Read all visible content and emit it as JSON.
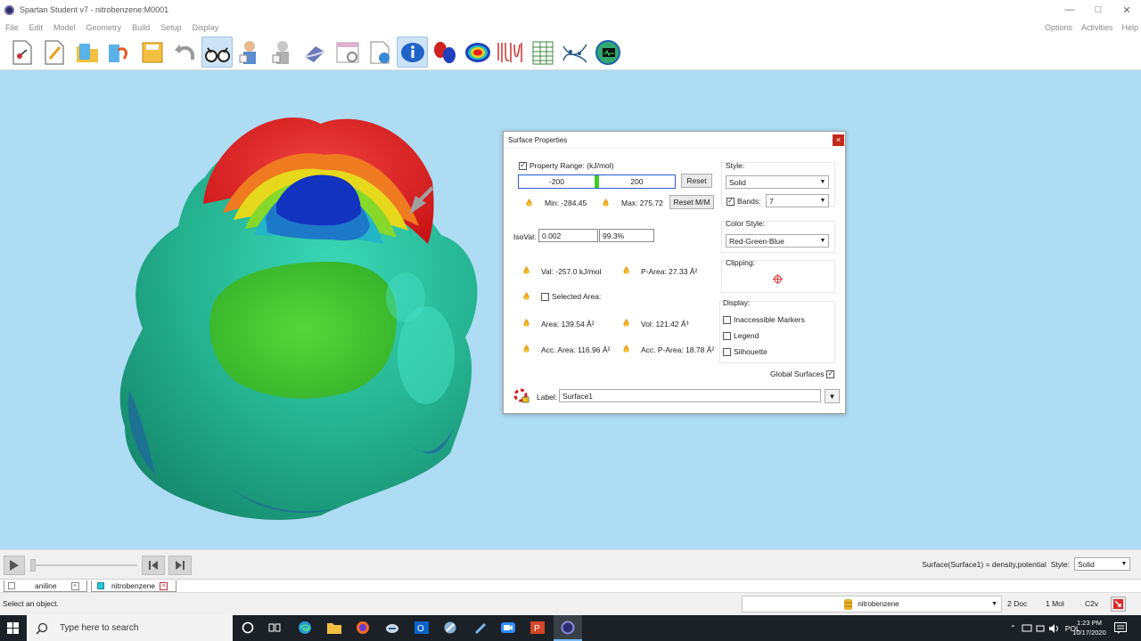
{
  "window": {
    "title": "Spartan Student v7 - nitrobenzene:M0001",
    "controls": [
      "minimize",
      "maximize",
      "close"
    ]
  },
  "menu": {
    "left": [
      "File",
      "Edit",
      "Model",
      "Geometry",
      "Build",
      "Setup",
      "Display"
    ],
    "right": [
      "Options",
      "Activities",
      "Help"
    ]
  },
  "toolbar": {
    "icons": [
      "new-molecule-icon",
      "new-document-icon",
      "open-folder-icon",
      "open-recent-icon",
      "save-icon",
      "undo-icon",
      "view-glasses-icon",
      "builder-icon",
      "expert-builder-icon",
      "eraser-icon",
      "calculations-icon",
      "surfaces-info-icon",
      "info-icon",
      "orbitals-icon",
      "potential-map-icon",
      "spectra-icon",
      "spreadsheet-icon",
      "plots-icon",
      "monitor-icon"
    ],
    "active_index": 6
  },
  "dialog": {
    "title": "Surface Properties",
    "close_label": "×",
    "property_range_label": "Property Range: (kJ/mol)",
    "property_range_checked": true,
    "range_min": "-200",
    "range_max": "200",
    "reset_label": "Reset",
    "min_text": "Min: -284.45",
    "max_text": "Max: 275.72",
    "reset_mm_label": "Reset M/M",
    "isoval_label": "IsoVal:",
    "isoval_value": "0.002",
    "isoval_percent": "99.3%",
    "val_text": "Val: -257.0  kJ/mol",
    "parea_text": "P-Area: 27.33 Å²",
    "selected_area_label": "Selected Area:",
    "area_text": "Area: 139.54 Å²",
    "vol_text": "Vol: 121.42 Å³",
    "acc_area_text": "Acc. Area: 116.96 Å²",
    "acc_parea_text": "Acc. P-Area: 18.78 Å²",
    "style_label": "Style:",
    "style_value": "Solid",
    "bands_label": "Bands:",
    "bands_checked": true,
    "bands_value": "7",
    "color_style_label": "Color Style:",
    "color_style_value": "Red-Green-Blue",
    "clipping_label": "Clipping:",
    "display_label": "Display:",
    "display_options": [
      {
        "label": "Inaccessible Markers",
        "checked": false
      },
      {
        "label": "Legend",
        "checked": false
      },
      {
        "label": "Silhouette",
        "checked": false
      }
    ],
    "global_surfaces_label": "Global Surfaces",
    "global_surfaces_checked": true,
    "label_label": "Label:",
    "label_value": "Surface1"
  },
  "animation": {
    "status_text": "Surface(Surface1) = density,potential",
    "style_label": "Style:",
    "style_value": "Solid"
  },
  "documents": {
    "tabs": [
      {
        "name": "aniline",
        "active": false
      },
      {
        "name": "nitrobenzene",
        "active": true
      }
    ]
  },
  "statusbar": {
    "message": "Select an object.",
    "selector_value": "nitrobenzene",
    "doc_count": "2 Doc",
    "mol_count": "1 Mol",
    "symmetry": "C2v"
  },
  "taskbar": {
    "search_placeholder": "Type here to search",
    "language": "POL",
    "time": "1:23 PM",
    "date": "10/17/2020"
  },
  "colors": {
    "viewport_bg": "#aedcf3",
    "surface_red": "#e61e1e",
    "surface_blue": "#1438c8",
    "surface_teal": "#28b888",
    "surface_green": "#3cc83c"
  }
}
